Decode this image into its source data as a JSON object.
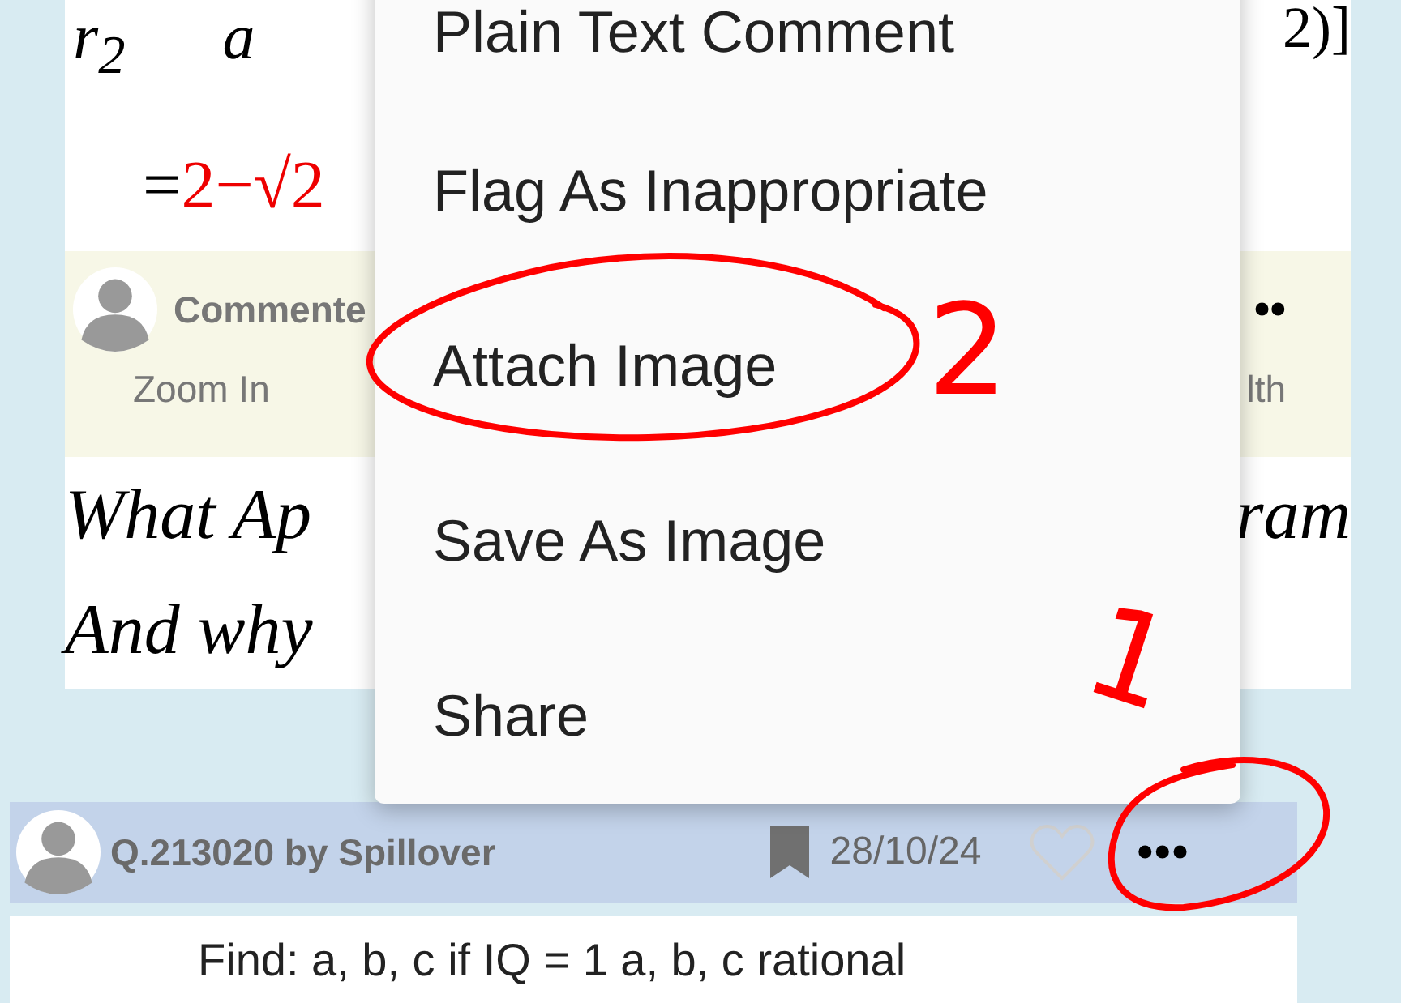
{
  "answer_card": {
    "math_line_1": [
      "r$_{2}$",
      "a",
      "2)]"
    ],
    "math_line_2": {
      "prefix": "=",
      "result": "2−√2"
    },
    "comment_bar": {
      "author": "Commente",
      "more": "••",
      "actions": [
        "Zoom In",
        "lth"
      ]
    },
    "text_lines": [
      {
        "left": "What Ap",
        "right": "ram"
      },
      {
        "left": "And why"
      }
    ]
  },
  "context_menu": {
    "items": [
      "Plain Text Comment",
      "Flag As Inappropriate",
      "Attach Image",
      "Save As Image",
      "Share"
    ]
  },
  "annotations": [
    {
      "mark": "2"
    },
    {
      "mark": "1"
    }
  ],
  "question_header": {
    "title": "Q.213020 by Spillover",
    "date": "28/10/24",
    "more": "•••"
  },
  "question_body": {
    "text": "Find: a, b, c if IQ = 1    a, b, c rational"
  }
}
